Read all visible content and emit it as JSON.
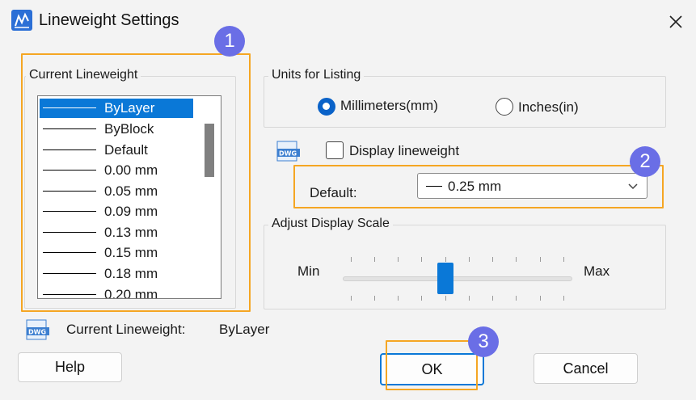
{
  "window": {
    "title": "Lineweight Settings"
  },
  "current_lineweight_group": {
    "label": "Current Lineweight",
    "items": [
      {
        "label": "ByLayer",
        "selected": true
      },
      {
        "label": "ByBlock"
      },
      {
        "label": "Default"
      },
      {
        "label": "0.00 mm"
      },
      {
        "label": "0.05 mm"
      },
      {
        "label": "0.09 mm"
      },
      {
        "label": "0.13 mm"
      },
      {
        "label": "0.15 mm"
      },
      {
        "label": "0.18 mm"
      },
      {
        "label": "0.20 mm"
      }
    ]
  },
  "units_group": {
    "label": "Units for Listing",
    "millimeters_label": "Millimeters(mm)",
    "inches_label": "Inches(in)",
    "selected": "millimeters"
  },
  "display_lineweight": {
    "label": "Display lineweight",
    "checked": false
  },
  "default_field": {
    "label": "Default:",
    "value": "0.25 mm"
  },
  "scale_group": {
    "label": "Adjust Display Scale",
    "min_label": "Min",
    "max_label": "Max",
    "level": 0.42
  },
  "status": {
    "label": "Current Lineweight:",
    "value": "ByLayer"
  },
  "buttons": {
    "help": "Help",
    "ok": "OK",
    "cancel": "Cancel"
  },
  "badges": {
    "one": "1",
    "two": "2",
    "three": "3"
  },
  "colors": {
    "accent": "#0a78d7",
    "highlight": "#f5a623",
    "badge": "#6a6ee6"
  },
  "icons": {
    "app": "lineweight-app-icon",
    "dwg": "dwg-file-icon",
    "close": "close-icon",
    "chevron": "chevron-down-icon"
  }
}
